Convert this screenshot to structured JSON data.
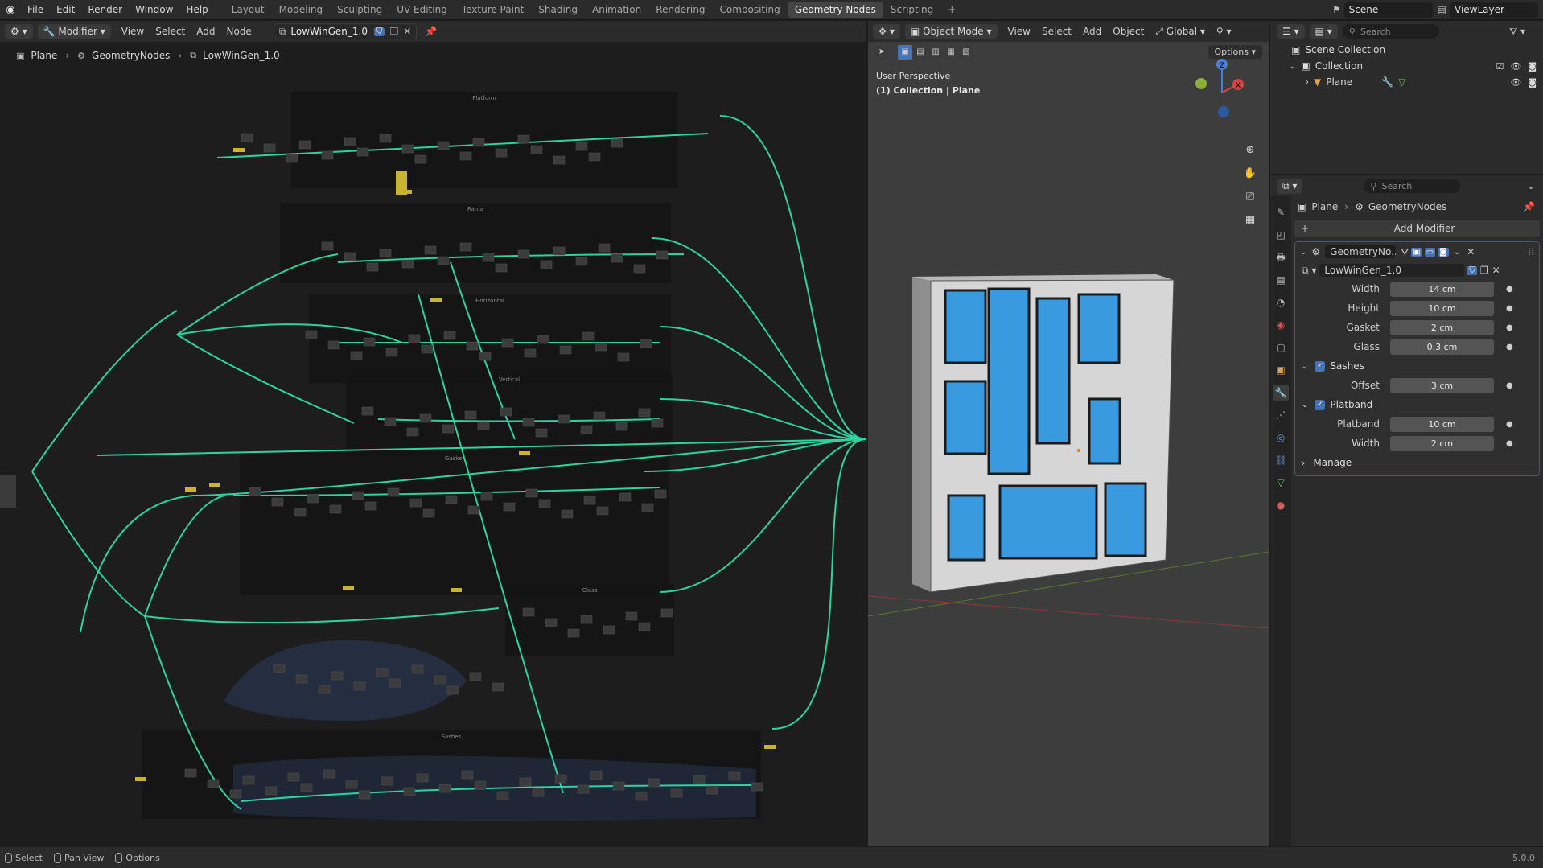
{
  "topbar": {
    "menus": [
      "File",
      "Edit",
      "Render",
      "Window",
      "Help"
    ],
    "workspaces": [
      "Layout",
      "Modeling",
      "Sculpting",
      "UV Editing",
      "Texture Paint",
      "Shading",
      "Animation",
      "Rendering",
      "Compositing",
      "Geometry Nodes",
      "Scripting"
    ],
    "active_workspace": "Geometry Nodes",
    "add_tab": "+",
    "scene": "Scene",
    "view_layer": "ViewLayer"
  },
  "node_editor": {
    "editor_type": "Modifier",
    "menus": [
      "View",
      "Select",
      "Add",
      "Node"
    ],
    "node_group": "LowWinGen_1.0",
    "breadcrumb": [
      "Plane",
      "GeometryNodes",
      "LowWinGen_1.0"
    ],
    "frames": [
      "Platform",
      "Rama",
      "Horizontal",
      "Vertical",
      "Gasket",
      "Glass",
      "Sashes"
    ]
  },
  "viewport": {
    "mode": "Object Mode",
    "menus": [
      "View",
      "Select",
      "Add",
      "Object"
    ],
    "orientation": "Global",
    "options_label": "Options",
    "perspective": "User Perspective",
    "collection_info": "(1) Collection | Plane",
    "gizmo_labels": {
      "z": "Z",
      "x": "X"
    }
  },
  "outliner": {
    "search_placeholder": "Search",
    "scene_collection": "Scene Collection",
    "collection": "Collection",
    "object": "Plane"
  },
  "properties": {
    "search_placeholder": "Search",
    "breadcrumb": [
      "Plane",
      "GeometryNodes"
    ],
    "add_modifier": "Add Modifier",
    "modifier_name": "GeometryNo...",
    "node_group": "LowWinGen_1.0",
    "fields": [
      {
        "label": "Width",
        "value": "14 cm"
      },
      {
        "label": "Height",
        "value": "10 cm"
      },
      {
        "label": "Gasket",
        "value": "2 cm"
      },
      {
        "label": "Glass",
        "value": "0.3 cm"
      }
    ],
    "sashes": {
      "label": "Sashes",
      "fields": [
        {
          "label": "Offset",
          "value": "3 cm"
        }
      ]
    },
    "platband": {
      "label": "Platband",
      "fields": [
        {
          "label": "Platband",
          "value": "10 cm"
        },
        {
          "label": "Width",
          "value": "2 cm"
        }
      ]
    },
    "manage": "Manage"
  },
  "statusbar": {
    "items": [
      "Select",
      "Pan View",
      "Options"
    ],
    "version": "5.0.0"
  },
  "colors": {
    "accent": "#4772b3",
    "link": "#2fd3a0",
    "glass": "#3a9ae0",
    "frame_bg": "#141414"
  }
}
